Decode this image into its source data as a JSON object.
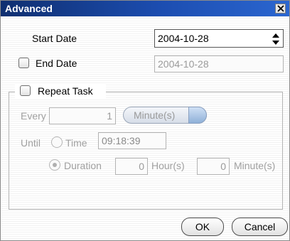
{
  "window": {
    "title": "Advanced",
    "close_icon": "close-icon"
  },
  "start_date": {
    "label": "Start Date",
    "value": "2004-10-28"
  },
  "end_date": {
    "label": "End Date",
    "value": "2004-10-28",
    "checked": false
  },
  "repeat": {
    "label": "Repeat Task",
    "checked": false,
    "every_label": "Every",
    "every_value": "1",
    "unit_selected": "Minute(s)",
    "until_label": "Until",
    "time_label": "Time",
    "time_value": "09:18:39",
    "duration_label": "Duration",
    "duration_hours": "0",
    "hours_label": "Hour(s)",
    "duration_minutes": "0",
    "minutes_label": "Minute(s)"
  },
  "buttons": {
    "ok": "OK",
    "cancel": "Cancel"
  }
}
